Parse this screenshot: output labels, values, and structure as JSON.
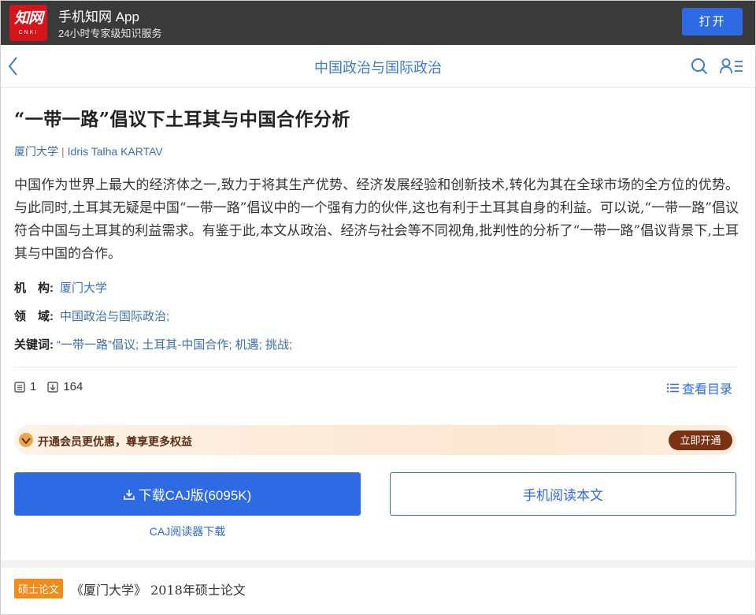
{
  "app_banner": {
    "logo_main": "知网",
    "logo_sub": "CNKI",
    "name": "手机知网 App",
    "subtitle": "24小时专家级知识服务",
    "open_label": "打开"
  },
  "header": {
    "title": "中国政治与国际政治",
    "accent_color": "#3b7bd1"
  },
  "article": {
    "title": "“一带一路”倡议下土耳其与中国合作分析",
    "institution_link": "厦门大学",
    "author": "Idris Talha KARTAV",
    "abstract": "中国作为世界上最大的经济体之一,致力于将其生产优势、经济发展经验和创新技术,转化为其在全球市场的全方位的优势。与此同时,土耳其无疑是中国“一带一路”倡议中的一个强有力的伙伴,这也有利于土耳其自身的利益。可以说,“一带一路”倡议符合中国与土耳其的利益需求。有鉴于此,本文从政治、经济与社会等不同视角,批判性的分析了“一带一路”倡议背景下,土耳其与中国的合作。",
    "meta": {
      "institution_label": "机　构:",
      "institution_value": "厦门大学",
      "field_label": "领　域:",
      "field_value": "中国政治与国际政治;",
      "keywords_label": "关键词:",
      "keywords_value": "“一带一路”倡议;  土耳其-中国合作;  机遇;  挑战;"
    },
    "stats": {
      "pages": "1",
      "downloads": "164"
    },
    "toc_label": "查看目录"
  },
  "vip": {
    "text": "开通会员更优惠，尊享更多权益",
    "button": "立即开通"
  },
  "actions": {
    "download_label": "下载CAJ版(6095K)",
    "read_label": "手机阅读本文",
    "reader_download": "CAJ阅读器下载"
  },
  "footer": {
    "badge": "硕士论文",
    "source": "《厦门大学》 2018年硕士论文"
  },
  "colors": {
    "primary": "#2d6ae3",
    "brand_red": "#d7141a",
    "badge_orange": "#f08c1a",
    "vip_brown": "#7a3212"
  }
}
